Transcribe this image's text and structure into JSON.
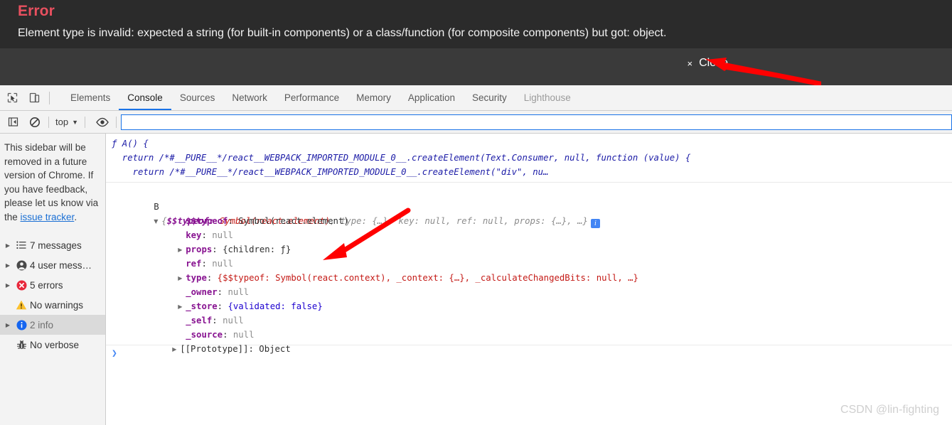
{
  "error_overlay": {
    "title": "Error",
    "message": "Element type is invalid: expected a string (for built-in components) or a class/function (for composite components) but got: object.",
    "close_x": "×",
    "close_label": "Close"
  },
  "devtools": {
    "icons": {
      "inspect": "inspect-element-icon",
      "device": "device-toolbar-icon",
      "sidebar_toggle": "sidebar-toggle-icon",
      "clear": "clear-console-icon",
      "eye": "live-expression-icon"
    },
    "tabs": [
      {
        "label": "Elements",
        "active": false,
        "dim": false
      },
      {
        "label": "Console",
        "active": true,
        "dim": false
      },
      {
        "label": "Sources",
        "active": false,
        "dim": false
      },
      {
        "label": "Network",
        "active": false,
        "dim": false
      },
      {
        "label": "Performance",
        "active": false,
        "dim": false
      },
      {
        "label": "Memory",
        "active": false,
        "dim": false
      },
      {
        "label": "Application",
        "active": false,
        "dim": false
      },
      {
        "label": "Security",
        "active": false,
        "dim": false
      },
      {
        "label": "Lighthouse",
        "active": false,
        "dim": true
      }
    ],
    "filterbar": {
      "context": "top",
      "caret": "▼",
      "filter_value": "",
      "filter_placeholder": ""
    },
    "sidebar": {
      "note_text_1": "This sidebar will be removed in a future version of Chrome. If you have feedback, please let us know via the ",
      "note_link": "issue tracker",
      "note_text_2": ".",
      "items": [
        {
          "label": "7 messages",
          "icon": "list-icon",
          "arrow": "▶",
          "selected": false
        },
        {
          "label": "4 user mess…",
          "icon": "user-icon",
          "arrow": "▶",
          "selected": false
        },
        {
          "label": "5 errors",
          "icon": "error-icon",
          "arrow": "▶",
          "selected": false
        },
        {
          "label": "No warnings",
          "icon": "warning-icon",
          "arrow": "",
          "selected": false
        },
        {
          "label": "2 info",
          "icon": "info-icon",
          "arrow": "▶",
          "selected": true
        },
        {
          "label": "No verbose",
          "icon": "bug-icon",
          "arrow": "",
          "selected": false
        }
      ]
    },
    "console": {
      "entry_function": {
        "line1": "ƒ A() {",
        "line2": "  return /*#__PURE__*/react__WEBPACK_IMPORTED_MODULE_0__.createElement(Text.Consumer, null, function (value) {",
        "line3": "    return /*#__PURE__*/react__WEBPACK_IMPORTED_MODULE_0__.createElement(\"div\", nu…"
      },
      "entry_object": {
        "label": "B",
        "arrow": "▼",
        "summary_open": "{",
        "summary_key1": "$$typeof:",
        "summary_val1": " Symbol(react.element)",
        "summary_rest": ", type: {…}, key: null, ref: null, props: {…}, …}",
        "badge": "i",
        "props": [
          {
            "arrow": "",
            "key": "$$typeof",
            "sep": ": ",
            "value": "Symbol(react.element)",
            "value_style": "dark"
          },
          {
            "arrow": "",
            "key": "key",
            "sep": ": ",
            "value": "null",
            "value_style": "gray"
          },
          {
            "arrow": "▶",
            "key": "props",
            "sep": ": ",
            "value": "{children: ƒ}",
            "value_style": "dark"
          },
          {
            "arrow": "",
            "key": "ref",
            "sep": ": ",
            "value": "null",
            "value_style": "gray"
          },
          {
            "arrow": "▶",
            "key": "type",
            "sep": ": ",
            "value": "{$$typeof: Symbol(react.context), _context: {…}, _calculateChangedBits: null, …}",
            "value_style": "mixed"
          },
          {
            "arrow": "",
            "key": "_owner",
            "sep": ": ",
            "value": "null",
            "value_style": "gray"
          },
          {
            "arrow": "▶",
            "key": "_store",
            "sep": ": ",
            "value": "{validated: false}",
            "value_style": "dark"
          },
          {
            "arrow": "",
            "key": "_self",
            "sep": ": ",
            "value": "null",
            "value_style": "gray"
          },
          {
            "arrow": "",
            "key": "_source",
            "sep": ": ",
            "value": "null",
            "value_style": "gray"
          },
          {
            "arrow": "▶",
            "key": "[[Prototype]]",
            "sep": ": ",
            "value": "Object",
            "value_style": "dark"
          }
        ]
      },
      "prompt_symbol": "❯"
    }
  },
  "watermark": "CSDN @lin-fighting",
  "colors": {
    "error_title": "#e8505f",
    "overlay_bg": "#2b2b2b",
    "actionbar_bg": "#3a3a3a",
    "accent_blue": "#1a73e8",
    "annotation_red": "#ff0000"
  }
}
